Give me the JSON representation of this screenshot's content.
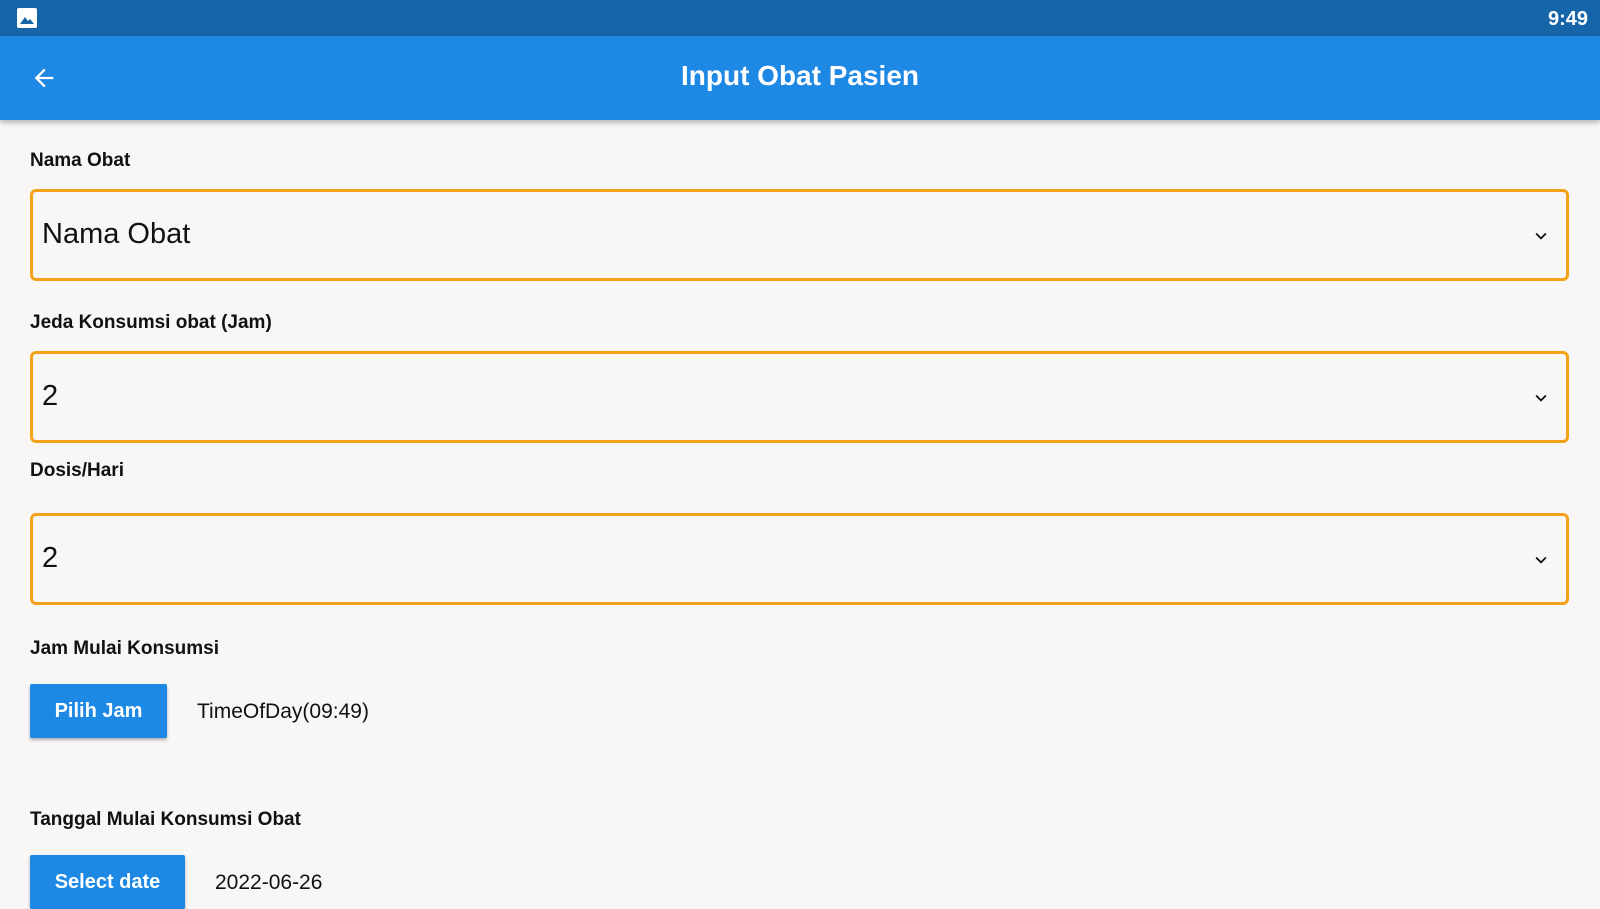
{
  "status_bar": {
    "time": "9:49",
    "notification_icon": "image-icon"
  },
  "app_bar": {
    "title": "Input Obat Pasien",
    "back_icon": "arrow-back-icon"
  },
  "form": {
    "nama_obat": {
      "label": "Nama Obat",
      "value": "Nama Obat"
    },
    "jeda_konsumsi": {
      "label": "Jeda Konsumsi obat (Jam)",
      "value": "2"
    },
    "dosis": {
      "label": "Dosis/Hari",
      "value": "2"
    },
    "jam_mulai": {
      "label": "Jam Mulai Konsumsi",
      "button_label": "Pilih Jam",
      "value": "TimeOfDay(09:49)"
    },
    "tanggal_mulai": {
      "label": "Tanggal Mulai Konsumsi Obat",
      "button_label": "Select date",
      "value": "2022-06-26"
    }
  },
  "colors": {
    "status_bar": "#1565a8",
    "app_bar": "#1e88e5",
    "field_border": "#f5a21b",
    "button": "#1e88e5",
    "background": "#f8f7f6"
  }
}
